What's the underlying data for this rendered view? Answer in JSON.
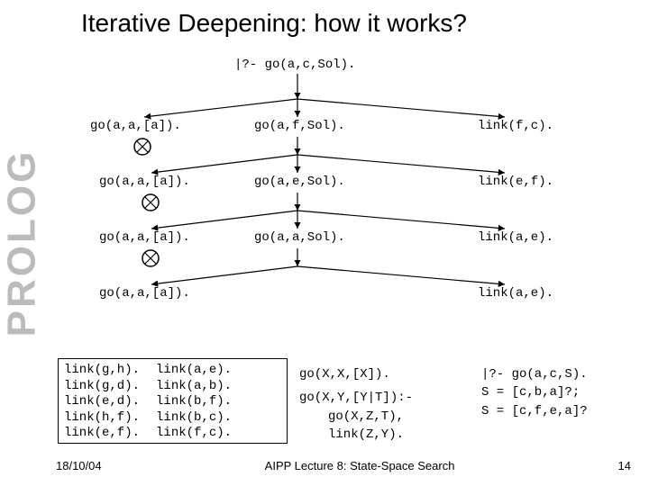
{
  "sidebar": "PROLOG",
  "title": "Iterative Deepening: how it works?",
  "query": "|?- go(a,c,Sol).",
  "tree": {
    "l1": "go(a,a,[a]).",
    "m1": "go(a,f,Sol).",
    "r1": "link(f,c).",
    "l2": "go(a,a,[a]).",
    "m2": "go(a,e,Sol).",
    "r2": "link(e,f).",
    "l3": "go(a,a,[a]).",
    "m3": "go(a,a,Sol).",
    "r3": "link(a,e).",
    "l4": "go(a,a,[a]).",
    "r4": "link(a,e)."
  },
  "facts": {
    "col1": [
      "link(g,h).",
      "link(g,d).",
      "link(e,d).",
      "link(h,f).",
      "link(e,f)."
    ],
    "col2": [
      "link(a,e).",
      "link(a,b).",
      "link(b,f).",
      "link(b,c).",
      "link(f,c)."
    ]
  },
  "rules": {
    "r1": "go(X,X,[X]).",
    "r2": "go(X,Y,[Y|T]):-",
    "r3": "go(X,Z,T),",
    "r4": "link(Z,Y)."
  },
  "answers": {
    "a1": "|?- go(a,c,S).",
    "a2": "S = [c,b,a]?;",
    "a3": "S = [c,f,e,a]?"
  },
  "footer": {
    "date": "18/10/04",
    "center": "AIPP Lecture 8: State-Space Search",
    "page": "14"
  }
}
